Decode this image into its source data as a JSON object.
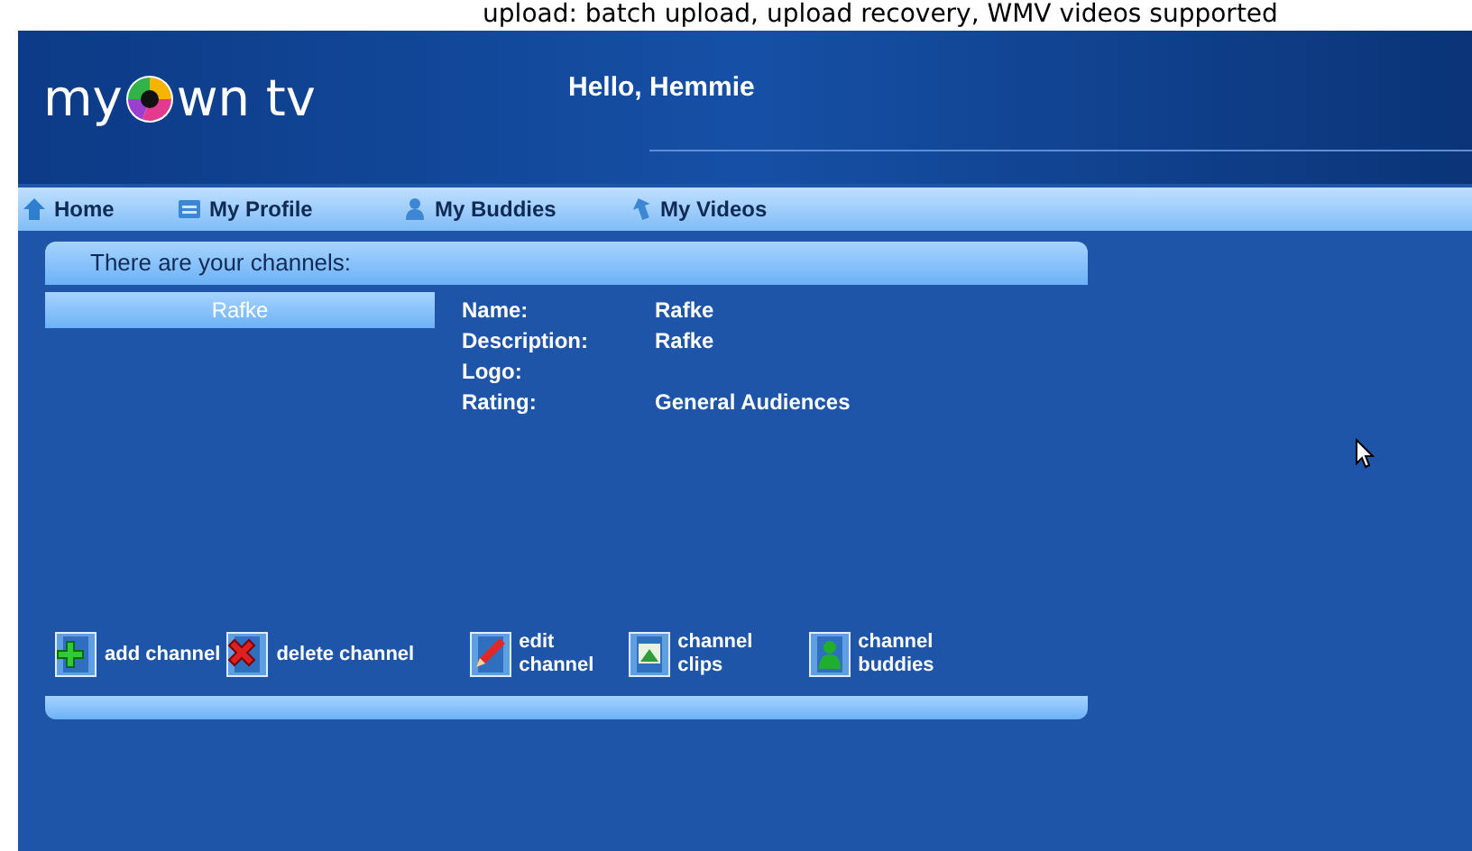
{
  "caption": "upload: batch upload, upload recovery, WMV videos supported",
  "logo": {
    "before": "my",
    "after": "wn tv"
  },
  "greeting": "Hello, Hemmie",
  "nav": [
    {
      "label": "Home"
    },
    {
      "label": "My Profile"
    },
    {
      "label": "My Buddies"
    },
    {
      "label": "My Videos"
    }
  ],
  "panel_title": "There are your channels:",
  "channels": [
    {
      "name": "Rafke",
      "selected": true
    }
  ],
  "details": [
    {
      "label": "Name:",
      "value": "Rafke"
    },
    {
      "label": "Description:",
      "value": "Rafke"
    },
    {
      "label": "Logo:"
    },
    {
      "label": "Rating:",
      "value": "General Audiences"
    }
  ],
  "actions": [
    {
      "label": "add channel"
    },
    {
      "label": "delete channel"
    },
    {
      "label": "edit channel"
    },
    {
      "label": "channel clips"
    },
    {
      "label": "channel buddies"
    }
  ]
}
